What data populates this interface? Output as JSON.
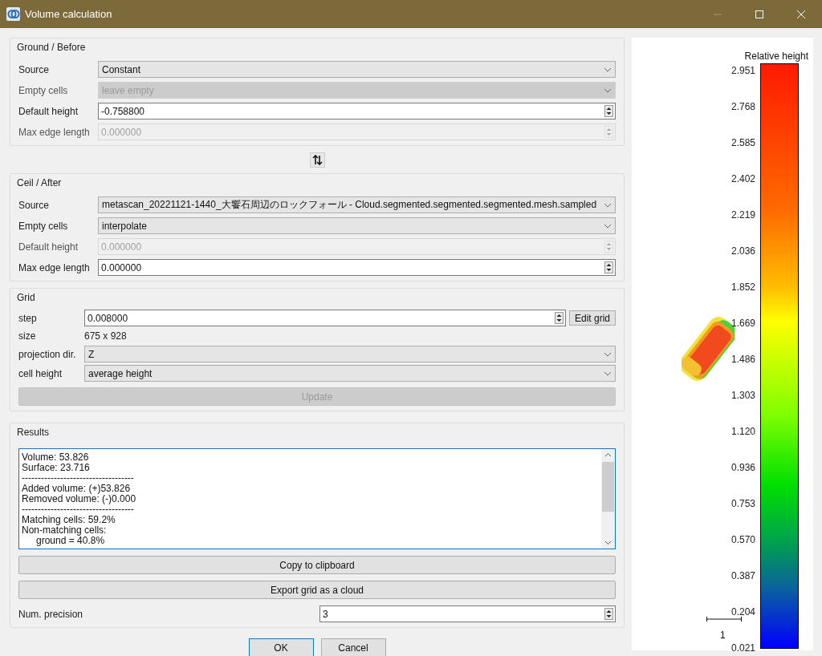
{
  "window": {
    "title": "Volume calculation"
  },
  "ground": {
    "title": "Ground / Before",
    "rows": [
      {
        "label": "Source",
        "kind": "combo",
        "value": "Constant",
        "disabled": false
      },
      {
        "label": "Empty cells",
        "kind": "combo",
        "value": "leave empty",
        "disabled": true
      },
      {
        "label": "Default height",
        "kind": "spin",
        "value": "-0.758800",
        "disabled": false
      },
      {
        "label": "Max edge length",
        "kind": "spin",
        "value": "0.000000",
        "disabled": true
      }
    ]
  },
  "ceil": {
    "title": "Ceil / After",
    "rows": [
      {
        "label": "Source",
        "kind": "combo",
        "value": "metascan_20221121-1440_大饗石周辺のロックフォール - Cloud.segmented.segmented.segmented.mesh.sampled",
        "disabled": false
      },
      {
        "label": "Empty cells",
        "kind": "combo",
        "value": "interpolate",
        "disabled": false
      },
      {
        "label": "Default height",
        "kind": "spin",
        "value": "0.000000",
        "disabled": true
      },
      {
        "label": "Max edge length",
        "kind": "spin",
        "value": "0.000000",
        "disabled": false
      }
    ]
  },
  "grid": {
    "title": "Grid",
    "rows": [
      {
        "label": "step",
        "kind": "spin",
        "value": "0.008000",
        "disabled": false,
        "button": "Edit grid"
      },
      {
        "label": "size",
        "kind": "text",
        "value": "675 x 928",
        "disabled": false
      },
      {
        "label": "projection dir.",
        "kind": "combo",
        "value": "Z",
        "disabled": false
      },
      {
        "label": "cell height",
        "kind": "combo",
        "value": "average height",
        "disabled": false
      }
    ],
    "update": {
      "label": "Update",
      "disabled": true
    }
  },
  "results": {
    "title": "Results",
    "lines": [
      {
        "text": "Volume: 53.826",
        "indent": false
      },
      {
        "text": "Surface: 23.716",
        "indent": false
      },
      {
        "text": "-----------------------------------",
        "indent": false
      },
      {
        "text": "Added volume: (+)53.826",
        "indent": false
      },
      {
        "text": "Removed volume: (-)0.000",
        "indent": false
      },
      {
        "text": "-----------------------------------",
        "indent": false
      },
      {
        "text": "Matching cells: 59.2%",
        "indent": false
      },
      {
        "text": "Non-matching cells:",
        "indent": false
      },
      {
        "text": "ground = 40.8%",
        "indent": true
      }
    ],
    "buttons": [
      "Copy to clipboard",
      "Export grid as a cloud"
    ],
    "precision": {
      "label": "Num. precision",
      "value": "3"
    }
  },
  "buttons": [
    {
      "label": "OK",
      "default": true
    },
    {
      "label": "Cancel",
      "default": false
    }
  ],
  "viewer": {
    "legend_title": "Relative height",
    "ticks": [
      "2.951",
      "2.768",
      "2.585",
      "2.402",
      "2.219",
      "2.036",
      "1.852",
      "1.669",
      "1.486",
      "1.303",
      "1.120",
      "0.936",
      "0.753",
      "0.570",
      "0.387",
      "0.204",
      "0.021"
    ],
    "scale_label": "1"
  }
}
